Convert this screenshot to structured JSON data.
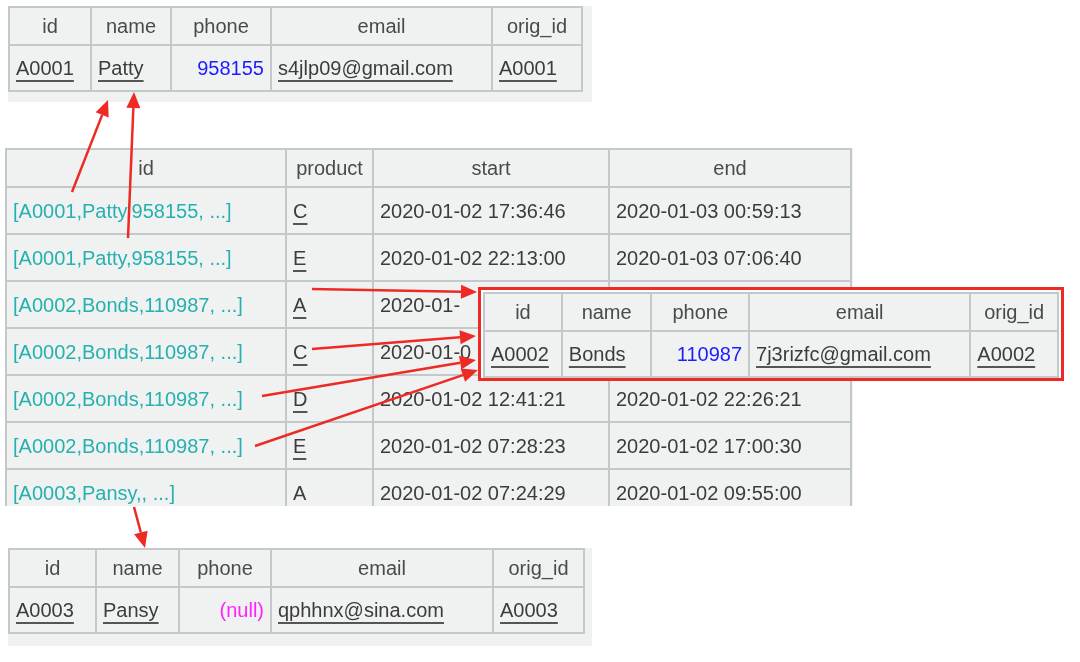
{
  "record_top": {
    "columns": [
      "id",
      "name",
      "phone",
      "email",
      "orig_id"
    ],
    "row": [
      {
        "text": "A0001",
        "kind": "link"
      },
      {
        "text": "Patty",
        "kind": "link"
      },
      {
        "text": "958155",
        "kind": "number"
      },
      {
        "text": "s4jlp09@gmail.com",
        "kind": "link"
      },
      {
        "text": "A0001",
        "kind": "link"
      }
    ]
  },
  "orders": {
    "columns": [
      "id",
      "product",
      "start",
      "end"
    ],
    "rows": [
      {
        "cells": [
          {
            "text": "[A0001,Patty,958155, ...]",
            "kind": "ref"
          },
          {
            "text": "C",
            "kind": "link"
          },
          {
            "text": "2020-01-02 17:36:46",
            "kind": "plain"
          },
          {
            "text": "2020-01-03 00:59:13",
            "kind": "plain"
          }
        ]
      },
      {
        "cells": [
          {
            "text": "[A0001,Patty,958155, ...]",
            "kind": "ref"
          },
          {
            "text": "E",
            "kind": "link"
          },
          {
            "text": "2020-01-02 22:13:00",
            "kind": "plain"
          },
          {
            "text": "2020-01-03 07:06:40",
            "kind": "plain"
          }
        ]
      },
      {
        "cells": [
          {
            "text": "[A0002,Bonds,110987, ...]",
            "kind": "ref"
          },
          {
            "text": "A",
            "kind": "link"
          },
          {
            "text": "2020-01-",
            "kind": "plain"
          }
        ]
      },
      {
        "cells": [
          {
            "text": "[A0002,Bonds,110987, ...]",
            "kind": "ref"
          },
          {
            "text": "C",
            "kind": "link"
          },
          {
            "text": "2020-01-0",
            "kind": "plain"
          }
        ]
      },
      {
        "cells": [
          {
            "text": "[A0002,Bonds,110987, ...]",
            "kind": "ref"
          },
          {
            "text": "D",
            "kind": "link"
          },
          {
            "text": "2020-01-02 12:41:21",
            "kind": "plain"
          },
          {
            "text": "2020-01-02 22:26:21",
            "kind": "plain"
          }
        ]
      },
      {
        "cells": [
          {
            "text": "[A0002,Bonds,110987, ...]",
            "kind": "ref"
          },
          {
            "text": "E",
            "kind": "link"
          },
          {
            "text": "2020-01-02 07:28:23",
            "kind": "plain"
          },
          {
            "text": "2020-01-02 17:00:30",
            "kind": "plain"
          }
        ]
      },
      {
        "cells": [
          {
            "text": "[A0003,Pansy,, ...]",
            "kind": "ref"
          },
          {
            "text": "A",
            "kind": "plain"
          },
          {
            "text": "2020-01-02 07:24:29",
            "kind": "plain"
          },
          {
            "text": "2020-01-02 09:55:00",
            "kind": "plain"
          }
        ]
      }
    ]
  },
  "record_popup": {
    "columns": [
      "id",
      "name",
      "phone",
      "email",
      "orig_id"
    ],
    "row": [
      {
        "text": "A0002",
        "kind": "link"
      },
      {
        "text": "Bonds",
        "kind": "link"
      },
      {
        "text": "110987",
        "kind": "number"
      },
      {
        "text": "7j3rizfc@gmail.com",
        "kind": "link"
      },
      {
        "text": "A0002",
        "kind": "link"
      }
    ]
  },
  "record_bottom": {
    "columns": [
      "id",
      "name",
      "phone",
      "email",
      "orig_id"
    ],
    "row": [
      {
        "text": "A0003",
        "kind": "link"
      },
      {
        "text": "Pansy",
        "kind": "link"
      },
      {
        "text": "(null)",
        "kind": "null"
      },
      {
        "text": "qphhnx@sina.com",
        "kind": "link"
      },
      {
        "text": "A0003",
        "kind": "link"
      }
    ]
  }
}
